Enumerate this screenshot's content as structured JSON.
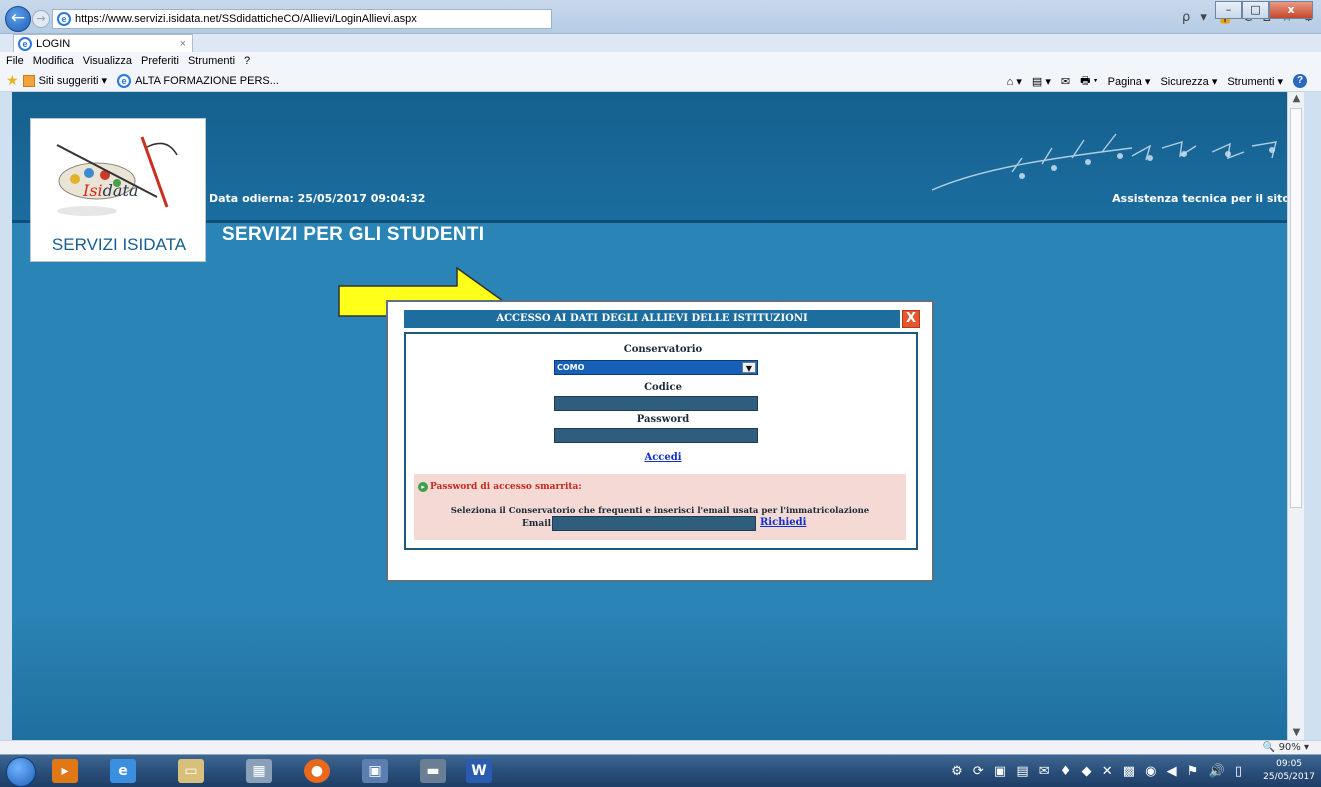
{
  "browser": {
    "url": "https://www.servizi.isidata.net/SSdidatticheCO/Allievi/LoginAllievi.aspx",
    "tab_title": "LOGIN",
    "tab_close": "×",
    "window_buttons": [
      "–",
      "□",
      "x"
    ],
    "address_icons": "ρ ▾ 🔒 C  ⌂ ☆ ⚙",
    "menu": [
      "File",
      "Modifica",
      "Visualizza",
      "Preferiti",
      "Strumenti",
      "?"
    ],
    "favorites": {
      "suggested": "Siti suggeriti ▾",
      "link": "ALTA FORMAZIONE PERS..."
    },
    "command_bar": {
      "home": "⌂ ▾",
      "feeds": "▤ ▾",
      "mail": "✉",
      "print": "🖶 ▾",
      "page": "Pagina ▾",
      "security": "Sicurezza ▾",
      "tools": "Strumenti ▾",
      "help": "?"
    },
    "zoom": "90%"
  },
  "page": {
    "logo_name_prefix": "Isi",
    "logo_name_suffix": "data",
    "logo_caption": "SERVIZI ISIDATA",
    "date_text": "Data odierna: 25/05/2017 09:04:32",
    "assist_link": "Assistenza tecnica per il sito",
    "title": "SERVIZI PER GLI STUDENTI"
  },
  "login": {
    "header": "ACCESSO AI DATI DEGLI ALLIEVI DELLE ISTITUZIONI",
    "close": "X",
    "conservatorio_label": "Conservatorio",
    "conservatorio_value": "COMO",
    "codice_label": "Codice",
    "codice_value": "",
    "password_label": "Password",
    "password_value": "",
    "submit": "Accedi",
    "lost_title": "Password di accesso smarrita:",
    "lost_desc": "Seleziona il Conservatorio che frequenti e inserisci l'email usata per l'immatricolazione",
    "email_label": "Email:",
    "email_value": "",
    "request": "Richiedi"
  },
  "taskbar": {
    "time": "09:05",
    "date": "25/05/2017"
  },
  "colors": {
    "page_bg": "#2a84b5",
    "header_bar": "#1d6d9e",
    "link": "#1030c8",
    "lost_bg": "#f4d9d5",
    "arrow": "#ffff1a"
  }
}
